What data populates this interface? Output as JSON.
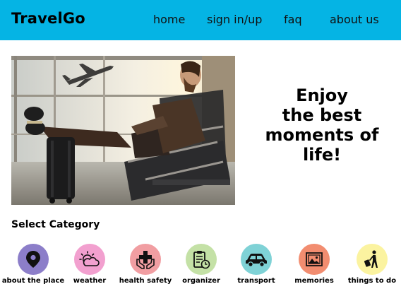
{
  "header": {
    "logo": "TravelGo",
    "nav": [
      "home",
      "sign in/up",
      "faq",
      "about us"
    ],
    "background": "#05b4e4"
  },
  "hero": {
    "tagline_lines": [
      "Enjoy",
      "the best",
      "moments of",
      "life!"
    ]
  },
  "categories": {
    "title": "Select Category",
    "items": [
      {
        "label": "about the place",
        "icon": "map-pin-icon",
        "color": "#8c7ec9"
      },
      {
        "label": "weather",
        "icon": "sun-cloud-icon",
        "color": "#f2a0cf"
      },
      {
        "label": "health safety",
        "icon": "medical-cross-hands-icon",
        "color": "#f19ea2"
      },
      {
        "label": "organizer",
        "icon": "clipboard-clock-icon",
        "color": "#c4e1a6"
      },
      {
        "label": "transport",
        "icon": "car-icon",
        "color": "#7fd2d6"
      },
      {
        "label": "memories",
        "icon": "photo-frame-icon",
        "color": "#f28d70"
      },
      {
        "label": "things to do",
        "icon": "traveler-luggage-icon",
        "color": "#fbf3a0"
      }
    ]
  }
}
